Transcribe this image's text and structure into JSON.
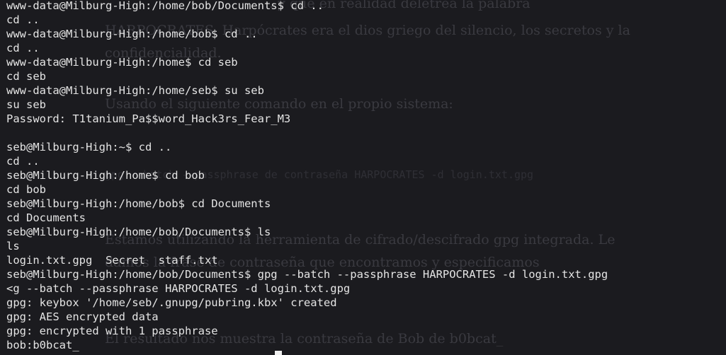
{
  "background_doc": [
    "... y que en realidad deletrea la palabra",
    "HARPOCRATES. Harpócrates era el dios griego del silencio, los secretos y la",
    "confidencialidad.",
    "Usando el siguiente comando en el propio sistema:",
    "gpg --batch --passphrase de contraseña HARPOCRATES -d login.txt.gpg",
    "Estamos utilizando la herramienta de cifrado/descifrado gpg integrada. Le",
    "damos la frase de contraseña que encontramos y especificamos",
    "El resultado nos muestra la contraseña de Bob de b0bcat_"
  ],
  "terminal": {
    "lines": [
      "www-data@Milburg-High:/home/bob/Documents$ cd ..",
      "cd ..",
      "www-data@Milburg-High:/home/bob$ cd ..",
      "cd ..",
      "www-data@Milburg-High:/home$ cd seb",
      "cd seb",
      "www-data@Milburg-High:/home/seb$ su seb",
      "su seb",
      "Password: T1tanium_Pa$$word_Hack3rs_Fear_M3",
      "",
      "seb@Milburg-High:~$ cd ..",
      "cd ..",
      "seb@Milburg-High:/home$ cd bob",
      "cd bob",
      "seb@Milburg-High:/home/bob$ cd Documents",
      "cd Documents",
      "seb@Milburg-High:/home/bob/Documents$ ls",
      "ls",
      "login.txt.gpg  Secret  staff.txt",
      "seb@Milburg-High:/home/bob/Documents$ gpg --batch --passphrase HARPOCRATES -d login.txt.gpg",
      "<g --batch --passphrase HARPOCRATES -d login.txt.gpg",
      "gpg: keybox '/home/seb/.gnupg/pubring.kbx' created",
      "gpg: AES encrypted data",
      "gpg: encrypted with 1 passphrase",
      "bob:b0bcat_"
    ]
  }
}
